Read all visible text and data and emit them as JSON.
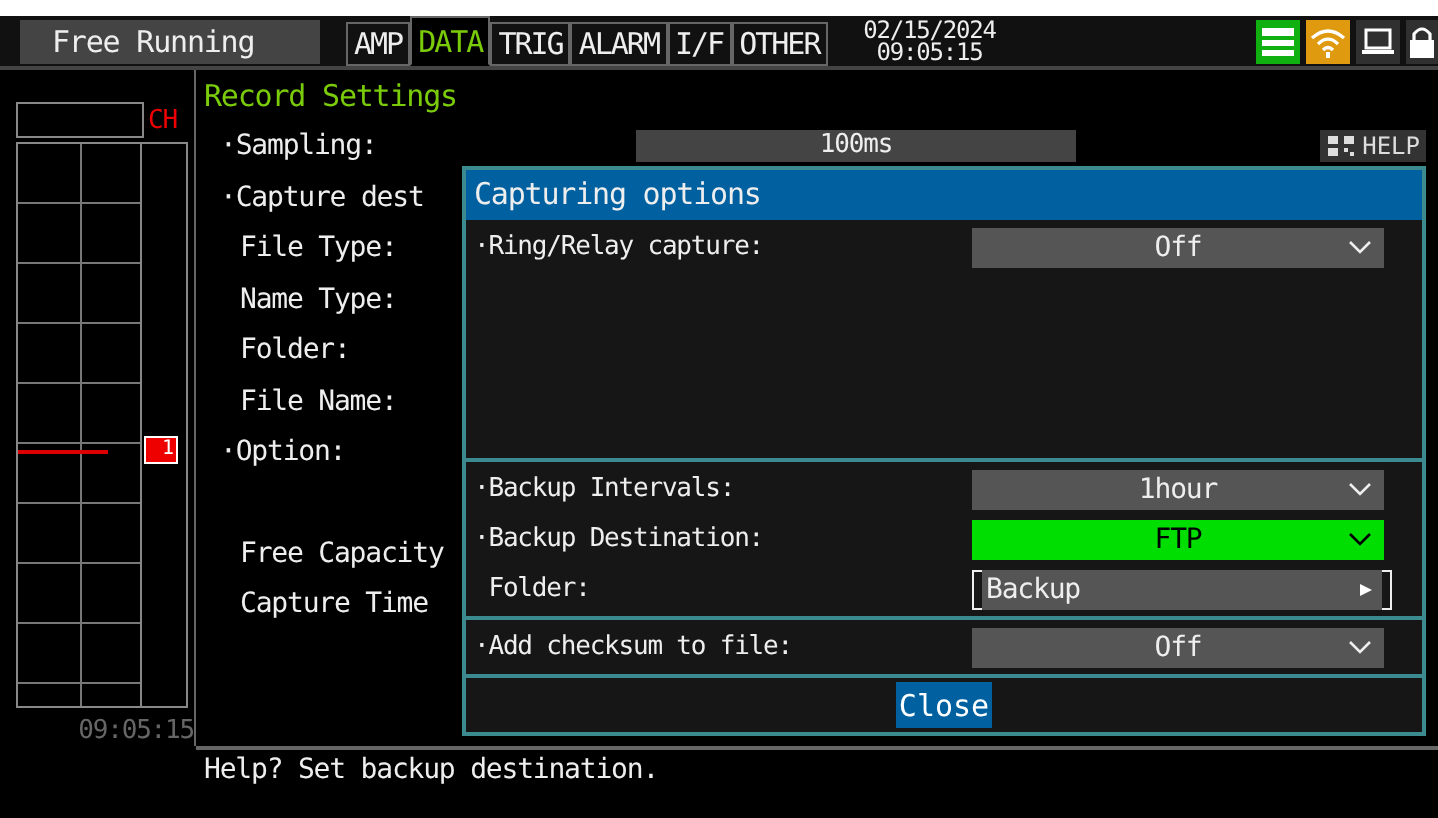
{
  "top_bar": {
    "mode": "Free Running",
    "tabs": [
      {
        "label": "AMP",
        "selected": false
      },
      {
        "label": "DATA",
        "selected": true
      },
      {
        "label": "TRIG",
        "selected": false
      },
      {
        "label": "ALARM",
        "selected": false
      },
      {
        "label": "I/F",
        "selected": false
      },
      {
        "label": "OTHER",
        "selected": false
      }
    ],
    "date": "02/15/2024",
    "time": "09:05:15"
  },
  "left_panel": {
    "channel_label": "CH",
    "marker": "1",
    "time": "09:05:15"
  },
  "record_settings": {
    "title": "Record Settings",
    "sampling_value": "100ms",
    "rows": [
      {
        "label": "·Sampling:",
        "kind": "item"
      },
      {
        "label": "·Capture dest",
        "kind": "item"
      },
      {
        "label": "File Type:",
        "kind": "sub"
      },
      {
        "label": "Name Type:",
        "kind": "sub"
      },
      {
        "label": "Folder:",
        "kind": "sub"
      },
      {
        "label": "File Name:",
        "kind": "sub"
      },
      {
        "label": "·Option:",
        "kind": "item"
      },
      {
        "kind": "gap"
      },
      {
        "label": "Free Capacity",
        "kind": "sub"
      },
      {
        "label": "Capture Time",
        "kind": "sub"
      }
    ]
  },
  "help_button": "HELP",
  "dialog": {
    "title": "Capturing options",
    "sections": [
      {
        "rows": [
          {
            "label": "·Ring/Relay capture:",
            "kind": "select",
            "value": "Off",
            "selected": false
          }
        ]
      },
      {
        "rows": [
          {
            "label": "·Backup Intervals:",
            "kind": "select",
            "value": "1hour",
            "selected": false
          },
          {
            "label": "·Backup Destination:",
            "kind": "select",
            "value": "FTP",
            "selected": true
          },
          {
            "label": " Folder:",
            "kind": "folder",
            "value": "Backup",
            "selected": false
          }
        ]
      },
      {
        "rows": [
          {
            "label": "·Add checksum to file:",
            "kind": "select",
            "value": "Off",
            "selected": false
          }
        ]
      }
    ],
    "close": "Close"
  },
  "help_line": "Help? Set backup destination."
}
